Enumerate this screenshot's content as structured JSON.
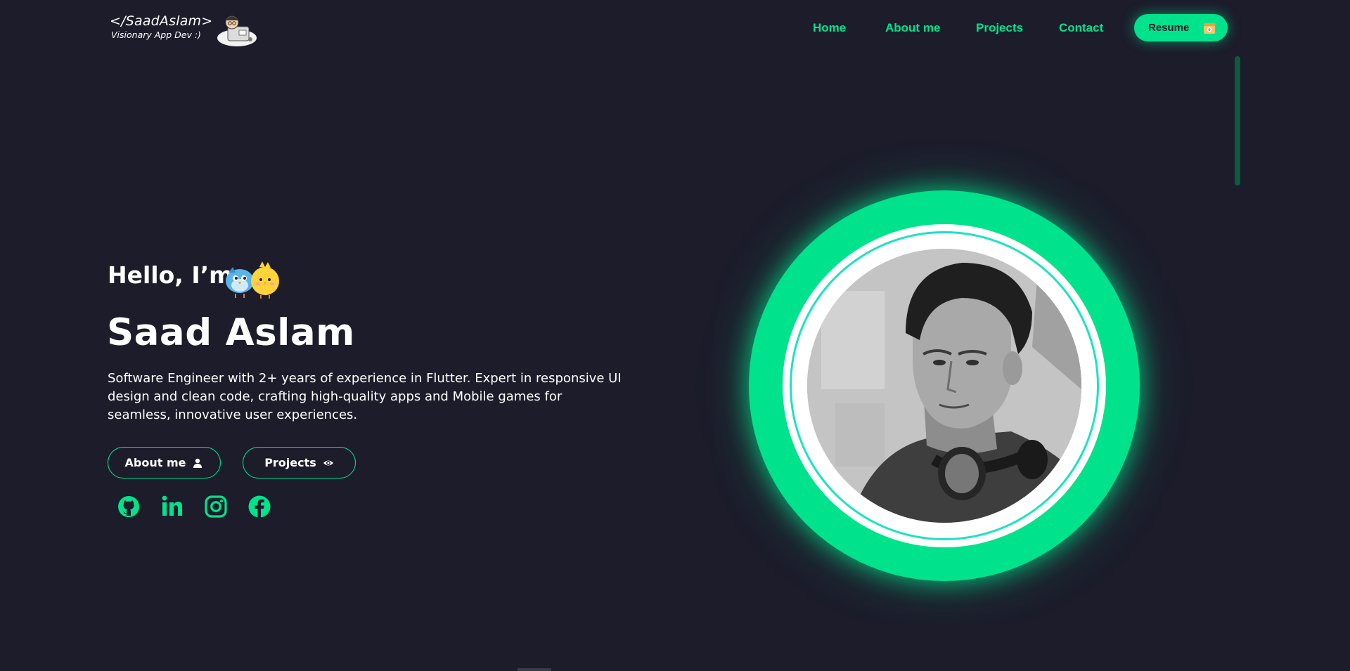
{
  "header": {
    "brand_title": "</SaadAslam>",
    "brand_subtitle": "Visionary App Dev :)",
    "nav": [
      {
        "label": "Home"
      },
      {
        "label": "About me"
      },
      {
        "label": "Projects"
      },
      {
        "label": "Contact"
      }
    ],
    "resume_label": "Resume",
    "resume_icon": "download-icon"
  },
  "hero": {
    "greeting": "Hello, I’m",
    "greeting_emoji": "bird-chick-emoji",
    "name": "Saad Aslam",
    "bio": "Software Engineer with 2+ years of experience in Flutter. Expert in responsive UI design and clean code, crafting high-quality apps and Mobile games for seamless, innovative user experiences.",
    "buttons": [
      {
        "label": "About me",
        "icon": "person-icon"
      },
      {
        "label": "Projects",
        "icon": "eye-icon"
      }
    ],
    "socials": [
      {
        "name": "github-icon"
      },
      {
        "name": "linkedin-icon"
      },
      {
        "name": "instagram-icon"
      },
      {
        "name": "facebook-icon"
      }
    ]
  },
  "colors": {
    "background": "#1c1c2b",
    "accent": "#00e38c",
    "text": "#ffffff"
  }
}
